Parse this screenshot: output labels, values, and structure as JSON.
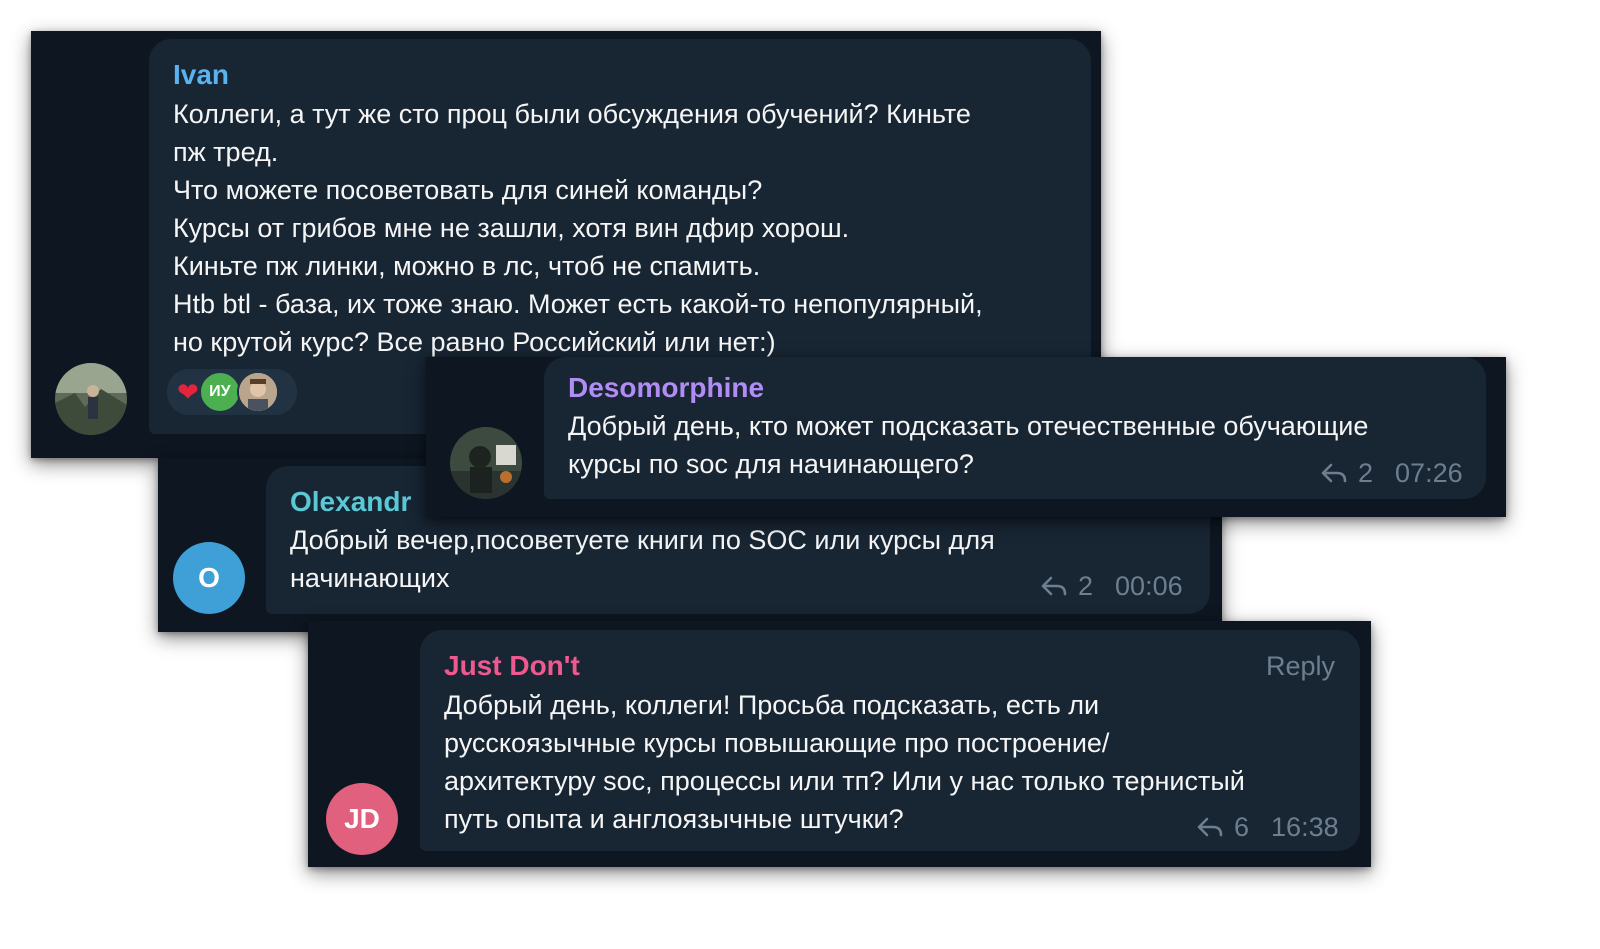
{
  "messages": {
    "ivan": {
      "author": "Ivan",
      "author_color": "#5ab3ee",
      "text": "Коллеги, а тут же сто проц были обсуждения обучений? Киньте\nпж тред.\nЧто можете посоветовать для синей команды?\nКурсы от грибов мне не зашли, хотя вин дфир хорош.\nКиньте пж линки, можно в лс, чтоб не спамить.\nHtb btl - база, их тоже знаю. Может есть какой-то непопулярный,\nно крутой курс? Все равно Российский или нет:)",
      "reactions": {
        "heart_icon": "red-heart",
        "initials": "ИУ",
        "initials_color": "#4caf50"
      }
    },
    "desomorphine": {
      "author": "Desomorphine",
      "author_color": "#b18cf5",
      "text": "Добрый день, кто может подсказать отечественные обучающие\nкурсы по soc для начинающего?",
      "replies": "2",
      "time": "07:26"
    },
    "olexandr": {
      "author": "Olexandr",
      "author_color": "#5bc8d6",
      "avatar_letter": "O",
      "avatar_color": "#3ea0d6",
      "text": "Добрый вечер,посоветуете книги по SOC или  курсы для\nначинающих",
      "replies": "2",
      "time": "00:06"
    },
    "justdont": {
      "author": "Just Don't",
      "author_color": "#ee5a8f",
      "avatar_letter": "JD",
      "avatar_color": "#e0607e",
      "reply_label": "Reply",
      "text": "Добрый день, коллеги! Просьба подсказать, есть ли\nрусскоязычные курсы повышающие про построение/\nархитектуру soc, процессы или тп?  Или у нас только тернистый\nпуть опыта и англоязычные штучки?",
      "replies": "6",
      "time": "16:38"
    }
  }
}
